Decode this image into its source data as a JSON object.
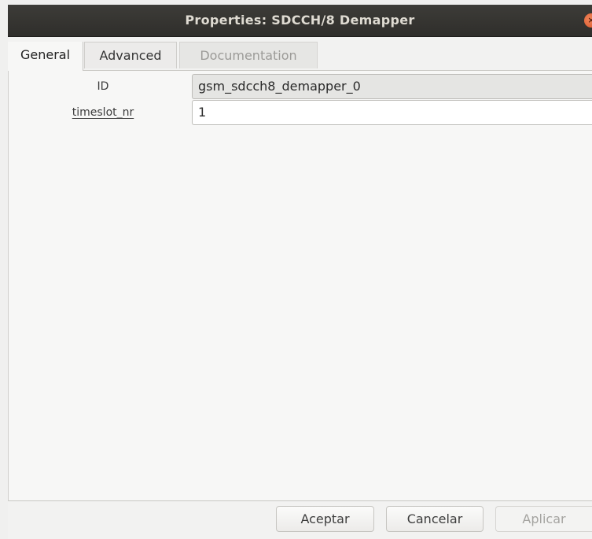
{
  "window": {
    "title": "Properties: SDCCH/8 Demapper",
    "close_symbol": "×"
  },
  "tabs": [
    {
      "label": "General",
      "active": true
    },
    {
      "label": "Advanced",
      "active": false
    },
    {
      "label": "Documentation",
      "active": false,
      "disabled": true
    }
  ],
  "general": {
    "fields": [
      {
        "label": "ID",
        "value": "gsm_sdcch8_demapper_0"
      },
      {
        "label": "timeslot_nr",
        "value": "1"
      }
    ]
  },
  "buttons": {
    "accept": "Aceptar",
    "cancel": "Cancelar",
    "apply": "Aplicar"
  },
  "colors": {
    "titlebar": "#33322f",
    "close_button": "#e0653a",
    "disabled_text": "#9c9b98"
  }
}
